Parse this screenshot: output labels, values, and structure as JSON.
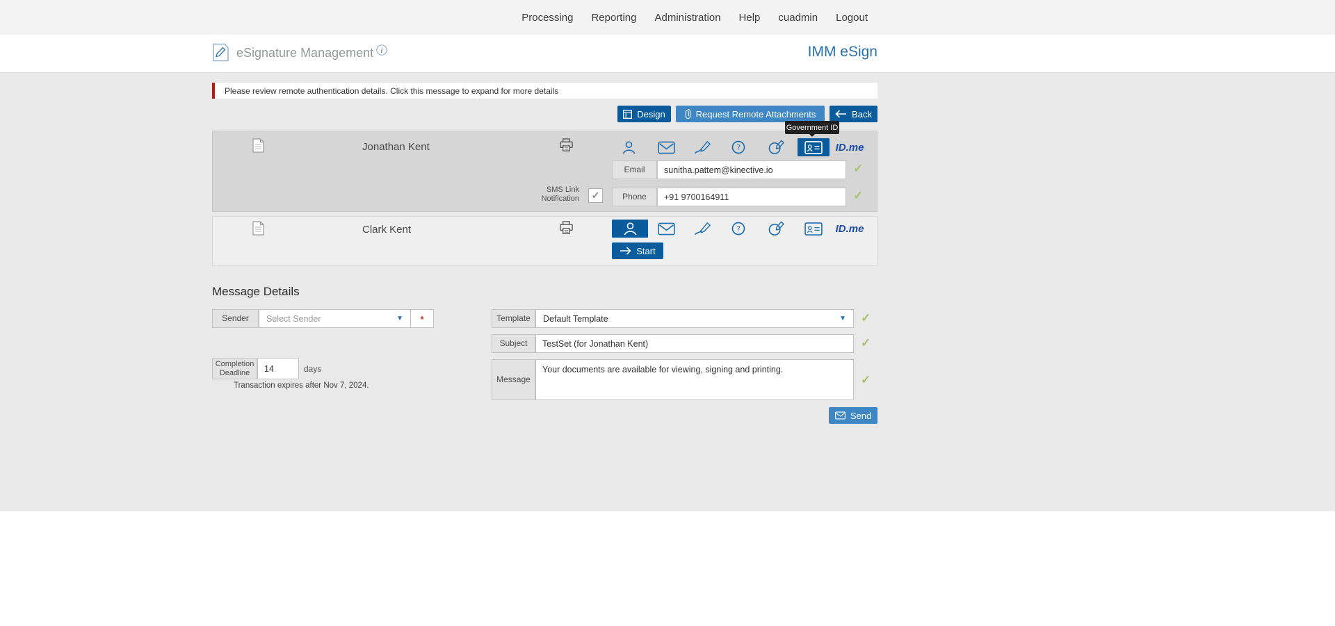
{
  "colors": {
    "primary_blue": "#0b5c9d",
    "secondary_blue": "#3e86c4",
    "brand_blue": "#2b6fad",
    "icon_blue": "#1f6fb2",
    "valid_green": "#a5c469",
    "alert_red": "#c41414"
  },
  "icons": {
    "check": "✓",
    "caret_down": "▼",
    "required_mark": "*"
  },
  "nav": {
    "items": [
      "Processing",
      "Reporting",
      "Administration",
      "Help",
      "cuadmin",
      "Logout"
    ]
  },
  "header": {
    "title": "eSignature Management",
    "brand": "IMM eSign"
  },
  "notification": {
    "text": "Please review remote authentication details. Click this message to expand for more details"
  },
  "toolbar": {
    "design_label": "Design",
    "request_remote_attachments_label": "Request Remote Attachments",
    "back_label": "Back"
  },
  "tooltip": {
    "text": "Government ID"
  },
  "idme_logo": "ID.me",
  "recipients": [
    {
      "name": "Jonathan Kent",
      "email_label": "Email",
      "email_value": "sunitha.pattem@kinective.io",
      "sms_label": "SMS Link Notification",
      "phone_label": "Phone",
      "phone_value": "+91 9700164911"
    },
    {
      "name": "Clark Kent",
      "start_label": "Start"
    }
  ],
  "message_details": {
    "heading": "Message Details",
    "sender_label": "Sender",
    "sender_placeholder": "Select Sender",
    "completion_deadline_label": "Completion Deadline",
    "completion_deadline_value": "14",
    "days_label": "days",
    "expiration_note": "Transaction expires after Nov 7, 2024.",
    "template_label": "Template",
    "template_value": "Default Template",
    "subject_label": "Subject",
    "subject_value": "TestSet (for Jonathan Kent)",
    "message_label": "Message",
    "message_value": "Your documents are available for viewing, signing and printing.",
    "send_label": "Send"
  }
}
